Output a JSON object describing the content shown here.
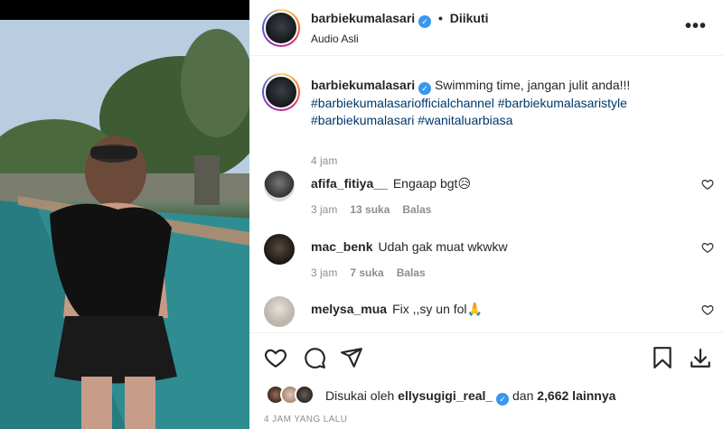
{
  "header": {
    "username": "barbiekumalasari",
    "separator": "•",
    "follow_status": "Diikuti",
    "subtitle": "Audio Asli",
    "more_icon": "more-horizontal-icon"
  },
  "caption": {
    "username": "barbiekumalasari",
    "text": "Swimming time, jangan julit anda!!!",
    "hashtags": [
      "#barbiekumalasariofficialchannel",
      "#barbiekumalasaristyle",
      "#barbiekumalasari",
      "#wanitaluarbiasa"
    ],
    "time": "4 jam"
  },
  "comments": [
    {
      "username": "afifa_fitiya__",
      "text": "Engaap bgt😥",
      "time": "3 jam",
      "likes": "13 suka",
      "reply": "Balas"
    },
    {
      "username": "mac_benk",
      "text": "Udah gak muat wkwkw",
      "time": "3 jam",
      "likes": "7 suka",
      "reply": "Balas"
    },
    {
      "username": "melysa_mua",
      "text": "Fix ,,sy un fol🙏",
      "time": "",
      "likes": "",
      "reply": ""
    }
  ],
  "actions": {
    "like_icon": "heart-icon",
    "comment_icon": "comment-icon",
    "share_icon": "send-icon",
    "save_icon": "bookmark-icon",
    "download_icon": "download-icon"
  },
  "likes": {
    "prefix": "Disukai oleh",
    "user": "ellysugigi_real_",
    "connector": "dan",
    "count": "2,662 lainnya"
  },
  "time_ago": "4 JAM YANG LALU",
  "colors": {
    "link": "#00376b",
    "verified": "#3897f0",
    "muted": "#8e8e8e",
    "text": "#262626"
  }
}
